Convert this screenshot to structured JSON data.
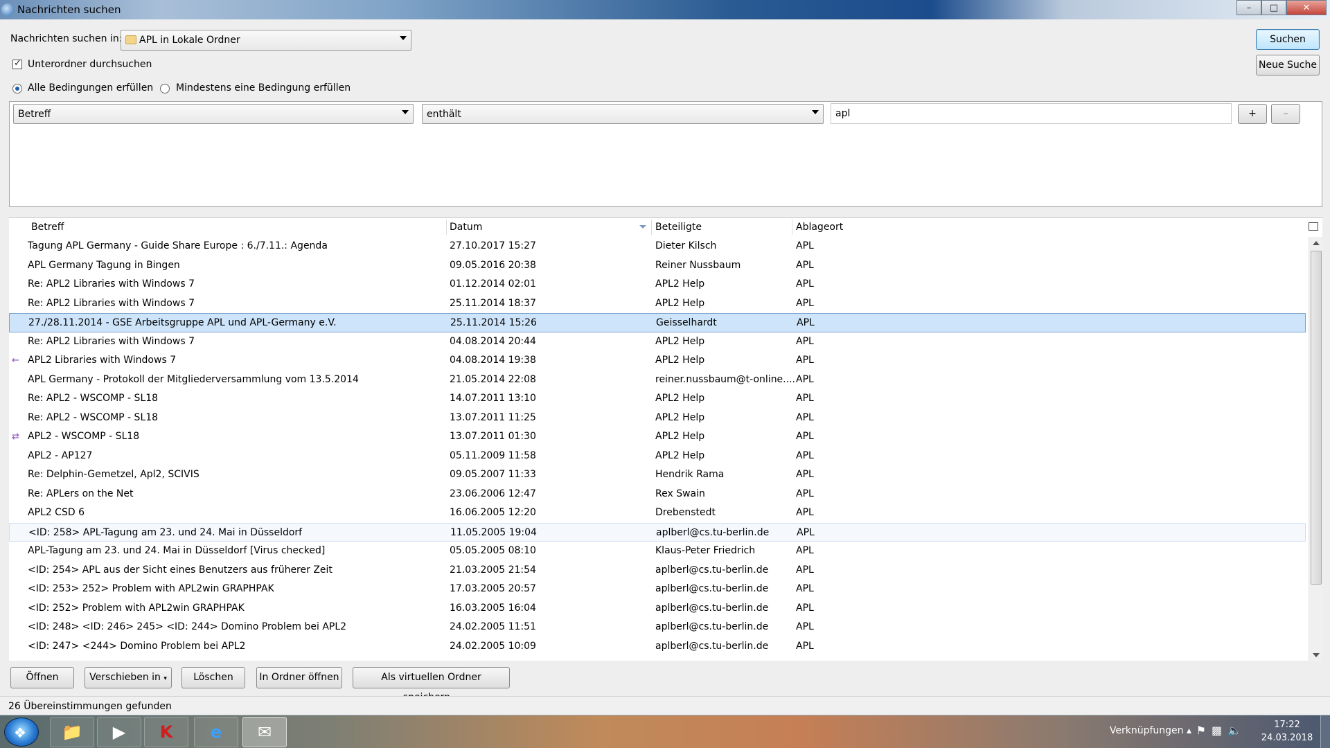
{
  "window": {
    "title": "Nachrichten suchen",
    "minimize": "–",
    "maximize": "□",
    "close": "✕"
  },
  "search": {
    "search_in_label": "Nachrichten suchen in:",
    "folder_value": "APL in Lokale Ordner",
    "subfolders_label": "Unterordner durchsuchen",
    "subfolders_checked": true,
    "match_all_label": "Alle Bedingungen erfüllen",
    "match_any_label": "Mindestens eine Bedingung erfüllen",
    "match_mode": "all",
    "search_button": "Suchen",
    "new_search_button": "Neue Suche"
  },
  "condition": {
    "field": "Betreff",
    "operator": "enthält",
    "value": "apl",
    "add_label": "+",
    "remove_label": "–"
  },
  "results": {
    "columns": {
      "subject": "Betreff",
      "date": "Datum",
      "participants": "Beteiligte",
      "location": "Ablageort"
    },
    "sorted_column": "date",
    "rows": [
      {
        "subject": "Tagung APL Germany - Guide Share Europe : 6./7.11.: Agenda",
        "date": "27.10.2017 15:27",
        "participants": "Dieter Kilsch",
        "location": "APL"
      },
      {
        "subject": "APL Germany Tagung in Bingen",
        "date": "09.05.2016 20:38",
        "participants": "Reiner Nussbaum",
        "location": "APL"
      },
      {
        "subject": "Re: APL2 Libraries with Windows 7",
        "date": "01.12.2014 02:01",
        "participants": "APL2 Help",
        "location": "APL"
      },
      {
        "subject": "Re: APL2 Libraries with Windows 7",
        "date": "25.11.2014 18:37",
        "participants": "APL2 Help",
        "location": "APL"
      },
      {
        "subject": "27./28.11.2014 - GSE Arbeitsgruppe APL und APL-Germany e.V.",
        "date": "25.11.2014 15:26",
        "participants": "Geisselhardt",
        "location": "APL",
        "state": "selected"
      },
      {
        "subject": "Re: APL2 Libraries with Windows 7",
        "date": "04.08.2014 20:44",
        "participants": "APL2 Help",
        "location": "APL"
      },
      {
        "subject": "APL2 Libraries with Windows 7",
        "date": "04.08.2014 19:38",
        "participants": "APL2 Help",
        "location": "APL",
        "icon": "replied-icon"
      },
      {
        "subject": "APL Germany - Protokoll der Mitgliederversammlung vom 13.5.2014",
        "date": "21.05.2014 22:08",
        "participants": "reiner.nussbaum@t-online....",
        "location": "APL"
      },
      {
        "subject": "Re: APL2 - WSCOMP - SL18",
        "date": "14.07.2011 13:10",
        "participants": "APL2 Help",
        "location": "APL"
      },
      {
        "subject": "Re: APL2 - WSCOMP - SL18",
        "date": "13.07.2011 11:25",
        "participants": "APL2 Help",
        "location": "APL"
      },
      {
        "subject": "APL2 - WSCOMP - SL18",
        "date": "13.07.2011 01:30",
        "participants": "APL2 Help",
        "location": "APL",
        "icon": "replied-forwarded-icon"
      },
      {
        "subject": "APL2 - AP127",
        "date": "05.11.2009 11:58",
        "participants": "APL2 Help",
        "location": "APL"
      },
      {
        "subject": "Re: Delphin-Gemetzel, Apl2, SCIVIS",
        "date": "09.05.2007 11:33",
        "participants": "Hendrik Rama",
        "location": "APL"
      },
      {
        "subject": "Re: APLers on the Net",
        "date": "23.06.2006 12:47",
        "participants": "Rex Swain",
        "location": "APL"
      },
      {
        "subject": "APL2 CSD 6",
        "date": "16.06.2005 12:20",
        "participants": "Drebenstedt",
        "location": "APL"
      },
      {
        "subject": "<ID: 258> APL-Tagung am 23. und 24. Mai in Düsseldorf",
        "date": "11.05.2005 19:04",
        "participants": "aplberl@cs.tu-berlin.de",
        "location": "APL",
        "state": "hover"
      },
      {
        "subject": "APL-Tagung am 23. und 24. Mai in Düsseldorf  [Virus checked]",
        "date": "05.05.2005 08:10",
        "participants": "Klaus-Peter Friedrich",
        "location": "APL"
      },
      {
        "subject": "<ID: 254> APL aus der Sicht eines Benutzers aus früherer Zeit",
        "date": "21.03.2005 21:54",
        "participants": "aplberl@cs.tu-berlin.de",
        "location": "APL"
      },
      {
        "subject": "<ID: 253>  252> Problem with APL2win GRAPHPAK",
        "date": "17.03.2005 20:57",
        "participants": "aplberl@cs.tu-berlin.de",
        "location": "APL"
      },
      {
        "subject": "<ID: 252> Problem with APL2win GRAPHPAK",
        "date": "16.03.2005 16:04",
        "participants": "aplberl@cs.tu-berlin.de",
        "location": "APL"
      },
      {
        "subject": "<ID: 248>  <ID: 246>  245>  <ID: 244> Domino Problem bei APL2",
        "date": "24.02.2005 11:51",
        "participants": "aplberl@cs.tu-berlin.de",
        "location": "APL"
      },
      {
        "subject": "<ID: 247> <244> Domino Problem bei APL2",
        "date": "24.02.2005 10:09",
        "participants": "aplberl@cs.tu-berlin.de",
        "location": "APL"
      }
    ]
  },
  "actions": {
    "open": "Öffnen",
    "move_to": "Verschieben in",
    "delete": "Löschen",
    "open_in_folder": "In Ordner öffnen",
    "save_virtual": "Als virtuellen Ordner speichern..."
  },
  "status": {
    "text": "26 Übereinstimmungen gefunden"
  },
  "taskbar": {
    "apps": [
      "explorer-icon",
      "media-player-icon",
      "kaspersky-icon",
      "internet-explorer-icon",
      "thunderbird-icon"
    ],
    "active_app": "thunderbird-icon",
    "links_label": "Verknüpfungen",
    "time": "17:22",
    "date": "24.03.2018"
  },
  "colors": {
    "selection": "#cde4fa",
    "selection_border": "#7da2ce",
    "default_button": "#bee6fd",
    "replied_icon": "#8a4fbf"
  }
}
